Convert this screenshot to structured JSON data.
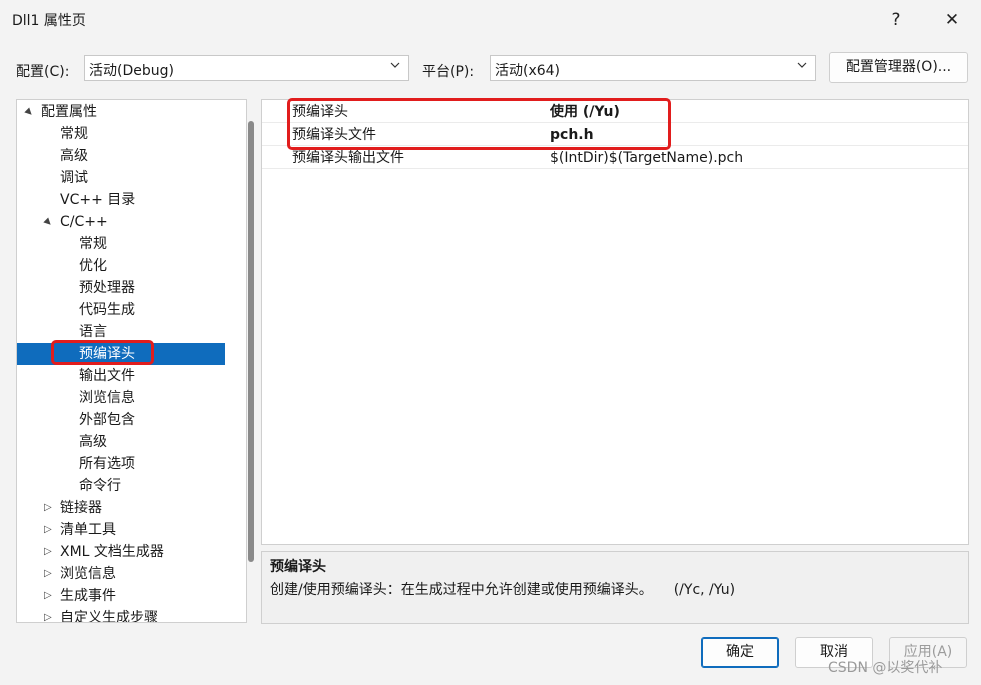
{
  "window": {
    "title": "Dll1 属性页",
    "help_icon": "?",
    "close_icon": "✕"
  },
  "config_bar": {
    "config_label": "配置(C):",
    "config_value": "活动(Debug)",
    "platform_label": "平台(P):",
    "platform_value": "活动(x64)",
    "manager_button": "配置管理器(O)..."
  },
  "tree": {
    "items": [
      {
        "label": "配置属性",
        "expander": "▲"
      },
      {
        "label": "常规"
      },
      {
        "label": "高级"
      },
      {
        "label": "调试"
      },
      {
        "label": "VC++ 目录"
      },
      {
        "label": "C/C++",
        "expander": "▲"
      },
      {
        "label": "常规"
      },
      {
        "label": "优化"
      },
      {
        "label": "预处理器"
      },
      {
        "label": "代码生成"
      },
      {
        "label": "语言"
      },
      {
        "label": "预编译头",
        "selected": true
      },
      {
        "label": "输出文件"
      },
      {
        "label": "浏览信息"
      },
      {
        "label": "外部包含"
      },
      {
        "label": "高级"
      },
      {
        "label": "所有选项"
      },
      {
        "label": "命令行"
      },
      {
        "label": "链接器",
        "expander": "▷"
      },
      {
        "label": "清单工具",
        "expander": "▷"
      },
      {
        "label": "XML 文档生成器",
        "expander": "▷"
      },
      {
        "label": "浏览信息",
        "expander": "▷"
      },
      {
        "label": "生成事件",
        "expander": "▷"
      },
      {
        "label": "自定义生成步骤",
        "expander": "▷"
      }
    ]
  },
  "properties": [
    {
      "name": "预编译头",
      "value": "使用 (/Yu)"
    },
    {
      "name": "预编译头文件",
      "value": "pch.h"
    },
    {
      "name": "预编译头输出文件",
      "value": "$(IntDir)$(TargetName).pch"
    }
  ],
  "description": {
    "title": "预编译头",
    "text": "创建/使用预编译头：在生成过程中允许创建或使用预编译头。　　(/Yc, /Yu)"
  },
  "buttons": {
    "ok": "确定",
    "cancel": "取消",
    "apply": "应用(A)"
  },
  "watermark": "CSDN @以奖代补",
  "colors": {
    "accent": "#0f6cbd",
    "highlight": "#e11d1d"
  }
}
